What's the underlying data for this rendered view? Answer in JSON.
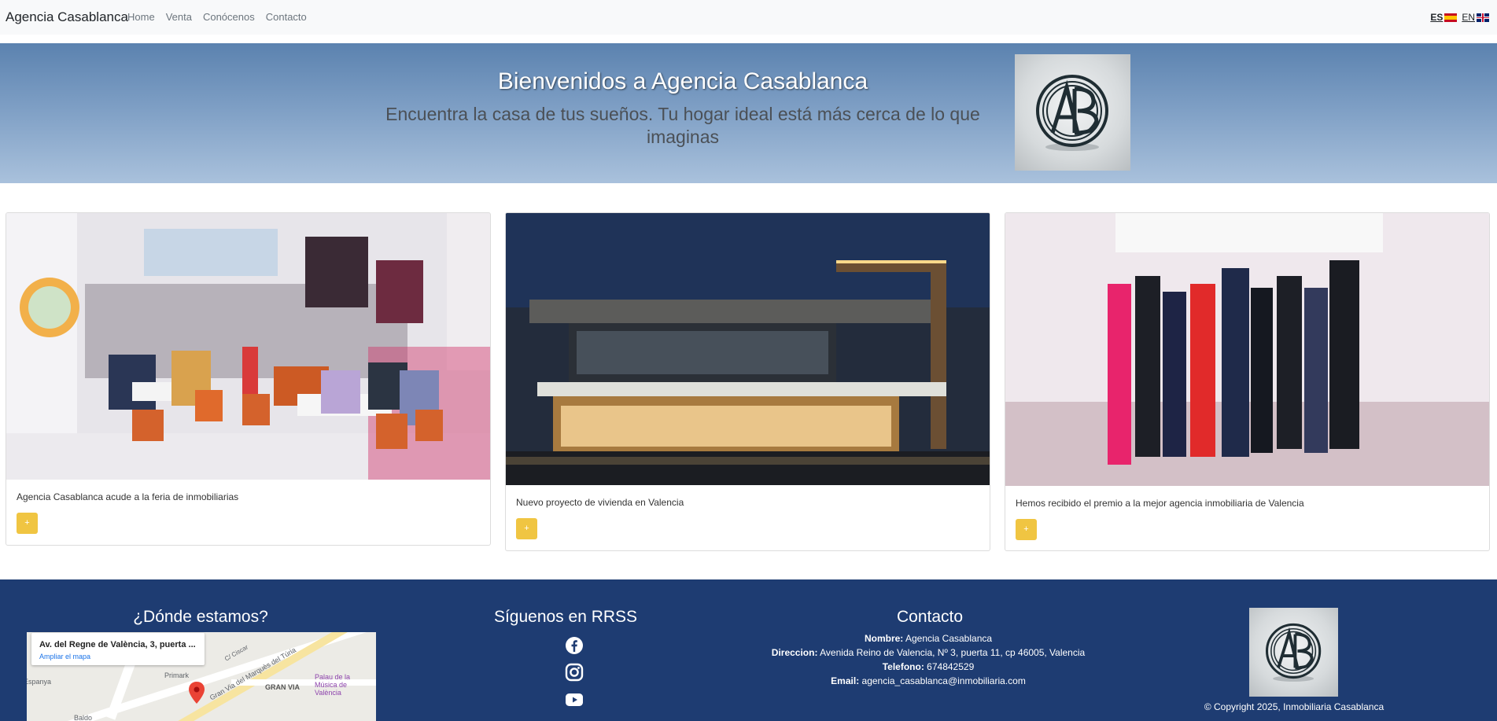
{
  "navbar": {
    "brand": "Agencia Casablanca",
    "links": [
      "Home",
      "Venta",
      "Conócenos",
      "Contacto"
    ],
    "lang_es": "ES",
    "lang_en": "EN"
  },
  "hero": {
    "title": "Bienvenidos a Agencia Casablanca",
    "subtitle": "Encuentra la casa de tus sueños. Tu hogar ideal está más cerca de lo que imaginas"
  },
  "cards": [
    {
      "text": "Agencia Casablanca acude a la feria de inmobiliarias",
      "button": "+"
    },
    {
      "text": "Nuevo proyecto de vivienda en Valencia",
      "button": "+"
    },
    {
      "text": "Hemos recibido el premio a la mejor agencia inmobiliaria de Valencia",
      "button": "+"
    }
  ],
  "footer": {
    "where_title": "¿Dónde estamos?",
    "map_address": "Av. del Regne de València, 3, puerta ...",
    "map_more": "Ampliar el mapa",
    "map_labels": [
      "C/ Ciscar",
      "Espanya",
      "Palau de la Música de València",
      "GRAN VIA",
      "Gran Via del Marquès del Túria",
      "Baldo",
      "Primark"
    ],
    "social_title": "Síguenos en RRSS",
    "contact_title": "Contacto",
    "contact": {
      "name_label": "Nombre:",
      "name_value": " Agencia Casablanca",
      "address_label": "Direccion:",
      "address_value": " Avenida Reino de Valencia, Nº 3, puerta 11, cp 46005, Valencia",
      "phone_label": "Telefono:",
      "phone_value": " 674842529",
      "email_label": "Email:",
      "email_value": " agencia_casablanca@inmobiliaria.com"
    },
    "copyright": "© Copyright 2025, Inmobiliaria Casablanca"
  },
  "colors": {
    "navbar_bg": "#f8f9fa",
    "footer_bg": "#1e3c72",
    "button_yellow": "#f0c542",
    "hero_gradient_top": "#5b82af",
    "hero_gradient_bottom": "#a9c1dc"
  }
}
